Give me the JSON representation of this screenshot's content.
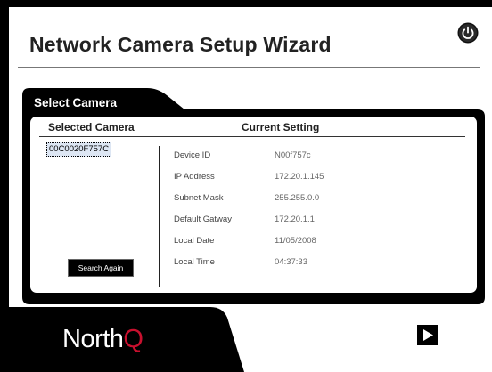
{
  "window": {
    "title": "Network Camera Setup Wizard"
  },
  "panel": {
    "title": "Select Camera",
    "selected_header": "Selected Camera",
    "current_header": "Current Setting"
  },
  "cameras": [
    "00C0020F757C"
  ],
  "settings": [
    {
      "label": "Device ID",
      "value": "N00f757c"
    },
    {
      "label": "IP Address",
      "value": "172.20.1.145"
    },
    {
      "label": "Subnet Mask",
      "value": "255.255.0.0"
    },
    {
      "label": "Default Gatway",
      "value": "172.20.1.1"
    },
    {
      "label": "Local Date",
      "value": "11/05/2008"
    },
    {
      "label": "Local Time",
      "value": "04:37:33"
    }
  ],
  "buttons": {
    "search_again": "Search Again"
  },
  "brand": {
    "name_main": "North",
    "name_accent": "Q",
    "accent_color": "#c8102e"
  },
  "icons": {
    "power": "power-icon",
    "next": "play-arrow-icon"
  }
}
